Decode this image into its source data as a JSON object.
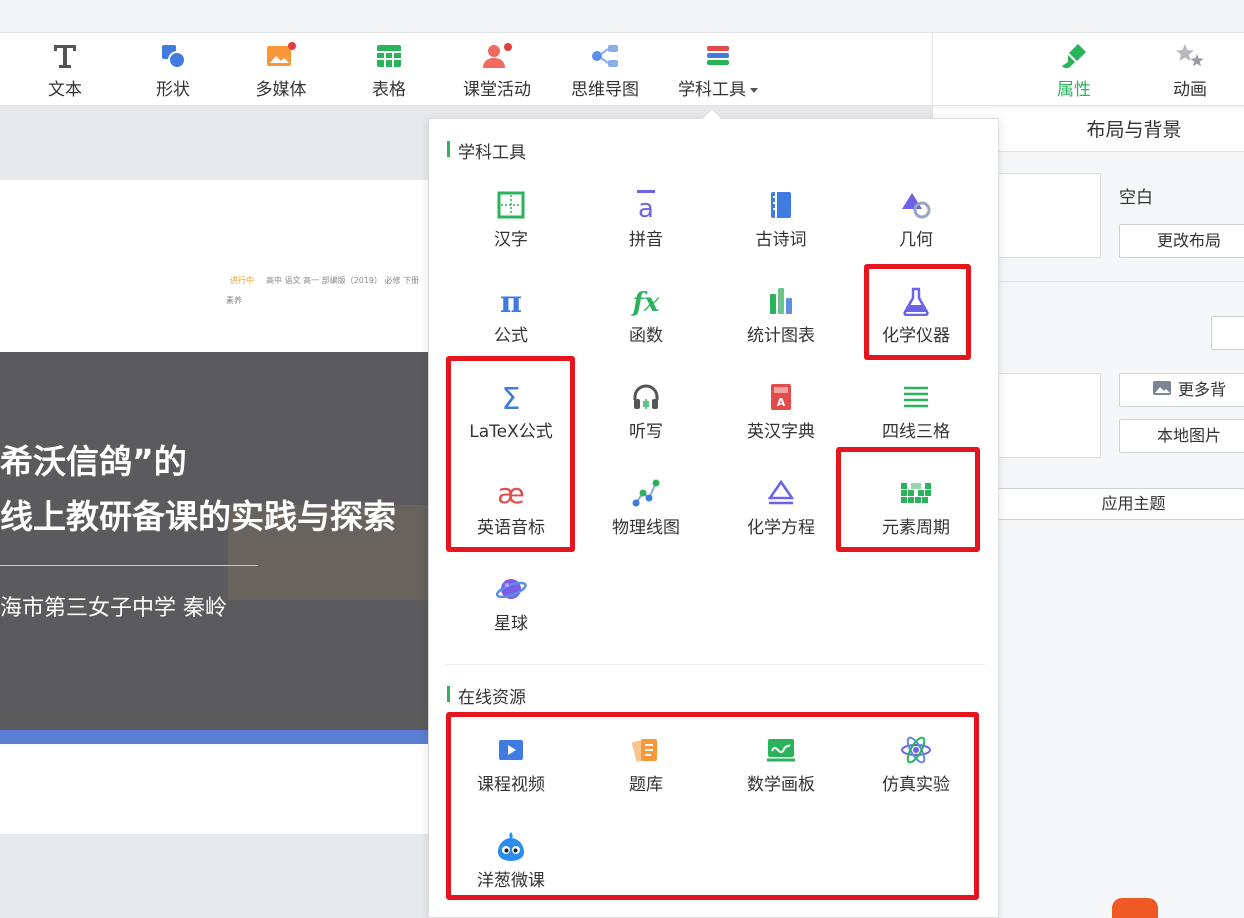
{
  "toolbar": {
    "items": [
      {
        "label": "文本",
        "icon": "text-T-icon"
      },
      {
        "label": "形状",
        "icon": "shape-icon"
      },
      {
        "label": "多媒体",
        "icon": "media-icon"
      },
      {
        "label": "表格",
        "icon": "table-icon"
      },
      {
        "label": "课堂活动",
        "icon": "classroom-activity-icon"
      },
      {
        "label": "思维导图",
        "icon": "mindmap-icon"
      },
      {
        "label": "学科工具",
        "icon": "subject-tools-icon"
      }
    ]
  },
  "right_panel": {
    "tabs": [
      {
        "label": "属性",
        "icon": "paintbrush-icon",
        "active": true
      },
      {
        "label": "动画",
        "icon": "stars-icon"
      }
    ],
    "title": "布局与背景",
    "blank_label": "空白",
    "change_layout": "更改布局",
    "more_bg": "更多背",
    "local_image": "本地图片",
    "apply_theme": "应用主题"
  },
  "slide": {
    "status_tag": "进行中",
    "meta_line": "高中 语文 高一 部编版（2019） 必修 下册",
    "meta_line2": "素养",
    "title_line1": "希沃信鸽”的",
    "title_line2": "线上教研备课的实践与探索",
    "author": "海市第三女子中学 秦岭"
  },
  "dropdown": {
    "section_tools": "学科工具",
    "section_online": "在线资源",
    "tools": [
      {
        "label": "汉字",
        "icon": "hanzi-grid-icon"
      },
      {
        "label": "拼音",
        "icon": "pinyin-a-icon"
      },
      {
        "label": "古诗词",
        "icon": "ancient-poem-book-icon"
      },
      {
        "label": "几何",
        "icon": "geometry-icon"
      },
      {
        "label": "公式",
        "icon": "pi-formula-icon"
      },
      {
        "label": "函数",
        "icon": "fx-function-icon"
      },
      {
        "label": "统计图表",
        "icon": "bar-chart-icon"
      },
      {
        "label": "化学仪器",
        "icon": "flask-icon"
      },
      {
        "label": "LaTeX公式",
        "icon": "sigma-latex-icon"
      },
      {
        "label": "听写",
        "icon": "headphones-icon"
      },
      {
        "label": "英汉字典",
        "icon": "dictionary-icon"
      },
      {
        "label": "四线三格",
        "icon": "four-lines-icon"
      },
      {
        "label": "英语音标",
        "icon": "phonetic-ae-icon"
      },
      {
        "label": "物理线图",
        "icon": "physics-graph-icon"
      },
      {
        "label": "化学方程",
        "icon": "chem-equation-icon"
      },
      {
        "label": "元素周期",
        "icon": "periodic-table-icon"
      },
      {
        "label": "星球",
        "icon": "planet-icon"
      }
    ],
    "online": [
      {
        "label": "课程视频",
        "icon": "video-icon"
      },
      {
        "label": "题库",
        "icon": "question-bank-icon"
      },
      {
        "label": "数学画板",
        "icon": "math-board-icon"
      },
      {
        "label": "仿真实验",
        "icon": "atom-icon"
      },
      {
        "label": "洋葱微课",
        "icon": "onion-mascot-icon"
      }
    ]
  },
  "colors": {
    "accent_green": "#2bb35c",
    "highlight_red": "#e5141d",
    "tool_blue": "#3f7be0"
  }
}
